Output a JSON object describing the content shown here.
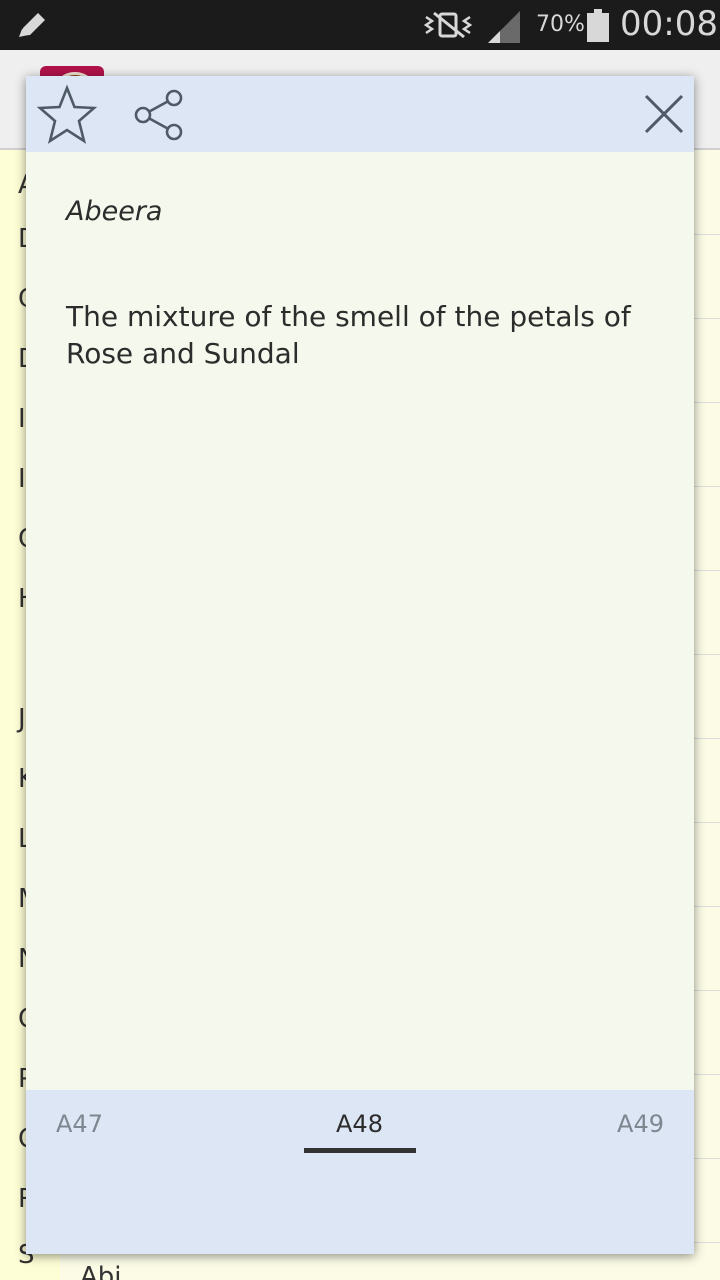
{
  "status_bar": {
    "battery_percent": "70%",
    "time": "00:08",
    "icons": [
      "pencil-icon",
      "vibrate-icon",
      "signal-icon",
      "battery-icon"
    ]
  },
  "background_list": {
    "index_letters": [
      "A",
      "D",
      "G",
      "D",
      "I",
      "I",
      "C",
      "H",
      "J",
      "K",
      "L",
      "M",
      "N",
      "O",
      "P",
      "Q",
      "R",
      "S"
    ],
    "partial_row_text": "Abi..."
  },
  "dialog": {
    "header_icons": [
      "star-icon",
      "share-icon",
      "close-icon"
    ],
    "entry": {
      "name": "Abeera",
      "meaning": "The mixture of the smell of the petals of Rose and Sundal"
    },
    "pager": {
      "prev": "A47",
      "current": "A48",
      "next": "A49"
    }
  },
  "colors": {
    "header_bg": "#dde6f5",
    "content_bg": "#f5f8ec",
    "status_bar_bg": "#1b1b1b",
    "index_bg": "#fefed6"
  }
}
